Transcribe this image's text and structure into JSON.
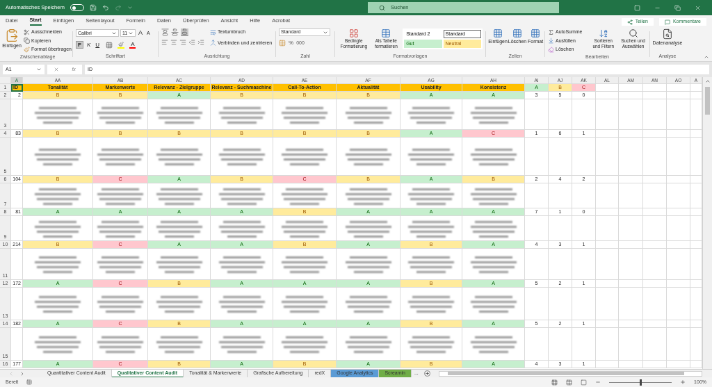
{
  "title_bar": {
    "autosave_label": "Automatisches Speichern",
    "autosave_on": false,
    "search_placeholder": "Suchen"
  },
  "menu": {
    "tabs": [
      {
        "label": "Datei",
        "selected": false
      },
      {
        "label": "Start",
        "selected": true
      },
      {
        "label": "Einfügen",
        "selected": false
      },
      {
        "label": "Seitenlayout",
        "selected": false
      },
      {
        "label": "Formeln",
        "selected": false
      },
      {
        "label": "Daten",
        "selected": false
      },
      {
        "label": "Überprüfen",
        "selected": false
      },
      {
        "label": "Ansicht",
        "selected": false
      },
      {
        "label": "Hilfe",
        "selected": false
      },
      {
        "label": "Acrobat",
        "selected": false
      }
    ],
    "share": "Teilen",
    "comments": "Kommentare"
  },
  "ribbon": {
    "clipboard": {
      "paste": "Einfügen",
      "cut": "Ausschneiden",
      "copy": "Kopieren",
      "format_painter": "Format übertragen",
      "label": "Zwischenablage"
    },
    "font": {
      "name": "Calibri",
      "size": "11",
      "grow": "A",
      "shrink": "A",
      "bold": "F",
      "bold_on": true,
      "italic": "K",
      "underline": "U",
      "font_color_label": "A",
      "label": "Schriftart"
    },
    "alignment": {
      "valign": [
        {
          "selected": false
        },
        {
          "selected": false
        },
        {
          "selected": true
        }
      ],
      "wrap": "Textumbruch",
      "merge": "Verbinden und zentrieren",
      "label": "Ausrichtung"
    },
    "number": {
      "format": "Standard",
      "percent": "%",
      "thousands": "000",
      "label": "Zahl"
    },
    "styles": {
      "conditional": "Bedingte Formatierung",
      "as_table": "Als Tabelle formatieren",
      "presets": [
        {
          "label": "Standard 2",
          "kind": "plain",
          "selected": false
        },
        {
          "label": "Standard",
          "kind": "plain",
          "selected": true
        },
        {
          "label": "Gut",
          "kind": "good",
          "selected": false
        },
        {
          "label": "Neutral",
          "kind": "neutral",
          "selected": false
        }
      ],
      "label": "Formatvorlagen"
    },
    "cells": {
      "insert": "Einfügen",
      "delete": "Löschen",
      "format": "Format",
      "label": "Zellen"
    },
    "editing": {
      "autosum": "AutoSumme",
      "fill": "Ausfüllen",
      "clear": "Löschen",
      "sort": "Sortieren und Filtern",
      "find": "Suchen und Auswählen",
      "label": "Bearbeiten"
    },
    "analysis": {
      "data_analysis": "Datenanalyse",
      "label": "Analyse"
    }
  },
  "formula_bar": {
    "cell": "A1",
    "fx": "fx",
    "value": "ID"
  },
  "sheet": {
    "columns": [
      "A",
      "AA",
      "AB",
      "AC",
      "AD",
      "AE",
      "AF",
      "AG",
      "AH",
      "AI",
      "AJ",
      "AK",
      "AL",
      "AM",
      "AN",
      "AO",
      "A"
    ],
    "header": {
      "row_number": "1",
      "id": "ID",
      "titles": [
        "Tonalität",
        "Markenwerte",
        "Relevanz - Zielgruppe",
        "Relevanz - Suchmaschine",
        "Call-To-Action",
        "Aktualität",
        "Usability",
        "Konsistenz"
      ],
      "tallies": [
        {
          "label": "A",
          "kind": "good"
        },
        {
          "label": "B",
          "kind": "neutral"
        },
        {
          "label": "C",
          "kind": "bad"
        }
      ]
    },
    "rows": [
      {
        "row_number": "2",
        "id": "2",
        "grades": [
          {
            "label": "B",
            "kind": "neutral"
          },
          {
            "label": "B",
            "kind": "neutral"
          },
          {
            "label": "A",
            "kind": "good"
          },
          {
            "label": "B",
            "kind": "neutral"
          },
          {
            "label": "B",
            "kind": "neutral"
          },
          {
            "label": "B",
            "kind": "neutral"
          },
          {
            "label": "A",
            "kind": "good"
          },
          {
            "label": "A",
            "kind": "good"
          }
        ],
        "counts": [
          "3",
          "5",
          "0"
        ],
        "notes_row_number": "3"
      },
      {
        "row_number": "4",
        "id": "83",
        "grades": [
          {
            "label": "B",
            "kind": "neutral"
          },
          {
            "label": "B",
            "kind": "neutral"
          },
          {
            "label": "B",
            "kind": "neutral"
          },
          {
            "label": "B",
            "kind": "neutral"
          },
          {
            "label": "B",
            "kind": "neutral"
          },
          {
            "label": "B",
            "kind": "neutral"
          },
          {
            "label": "A",
            "kind": "good"
          },
          {
            "label": "C",
            "kind": "bad"
          }
        ],
        "counts": [
          "1",
          "6",
          "1"
        ],
        "notes_row_number": "5"
      },
      {
        "row_number": "6",
        "id": "104",
        "grades": [
          {
            "label": "B",
            "kind": "neutral"
          },
          {
            "label": "C",
            "kind": "bad"
          },
          {
            "label": "A",
            "kind": "good"
          },
          {
            "label": "B",
            "kind": "neutral"
          },
          {
            "label": "C",
            "kind": "bad"
          },
          {
            "label": "B",
            "kind": "neutral"
          },
          {
            "label": "A",
            "kind": "good"
          },
          {
            "label": "B",
            "kind": "neutral"
          }
        ],
        "counts": [
          "2",
          "4",
          "2"
        ],
        "notes_row_number": "7"
      },
      {
        "row_number": "8",
        "id": "81",
        "grades": [
          {
            "label": "A",
            "kind": "good"
          },
          {
            "label": "A",
            "kind": "good"
          },
          {
            "label": "A",
            "kind": "good"
          },
          {
            "label": "A",
            "kind": "good"
          },
          {
            "label": "B",
            "kind": "neutral"
          },
          {
            "label": "A",
            "kind": "good"
          },
          {
            "label": "A",
            "kind": "good"
          },
          {
            "label": "A",
            "kind": "good"
          }
        ],
        "counts": [
          "7",
          "1",
          "0"
        ],
        "notes_row_number": "9"
      },
      {
        "row_number": "10",
        "id": "214",
        "grades": [
          {
            "label": "B",
            "kind": "neutral"
          },
          {
            "label": "C",
            "kind": "bad"
          },
          {
            "label": "A",
            "kind": "good"
          },
          {
            "label": "A",
            "kind": "good"
          },
          {
            "label": "B",
            "kind": "neutral"
          },
          {
            "label": "A",
            "kind": "good"
          },
          {
            "label": "B",
            "kind": "neutral"
          },
          {
            "label": "A",
            "kind": "good"
          }
        ],
        "counts": [
          "4",
          "3",
          "1"
        ],
        "notes_row_number": "11"
      },
      {
        "row_number": "12",
        "id": "172",
        "grades": [
          {
            "label": "A",
            "kind": "good"
          },
          {
            "label": "C",
            "kind": "bad"
          },
          {
            "label": "B",
            "kind": "neutral"
          },
          {
            "label": "A",
            "kind": "good"
          },
          {
            "label": "A",
            "kind": "good"
          },
          {
            "label": "A",
            "kind": "good"
          },
          {
            "label": "B",
            "kind": "neutral"
          },
          {
            "label": "A",
            "kind": "good"
          }
        ],
        "counts": [
          "5",
          "2",
          "1"
        ],
        "notes_row_number": "13"
      },
      {
        "row_number": "14",
        "id": "182",
        "grades": [
          {
            "label": "A",
            "kind": "good"
          },
          {
            "label": "C",
            "kind": "bad"
          },
          {
            "label": "B",
            "kind": "neutral"
          },
          {
            "label": "A",
            "kind": "good"
          },
          {
            "label": "A",
            "kind": "good"
          },
          {
            "label": "A",
            "kind": "good"
          },
          {
            "label": "B",
            "kind": "neutral"
          },
          {
            "label": "A",
            "kind": "good"
          }
        ],
        "counts": [
          "5",
          "2",
          "1"
        ],
        "notes_row_number": "15"
      },
      {
        "row_number": "16",
        "id": "177",
        "grades": [
          {
            "label": "A",
            "kind": "good"
          },
          {
            "label": "C",
            "kind": "bad"
          },
          {
            "label": "B",
            "kind": "neutral"
          },
          {
            "label": "A",
            "kind": "good"
          },
          {
            "label": "B",
            "kind": "neutral"
          },
          {
            "label": "A",
            "kind": "good"
          },
          {
            "label": "B",
            "kind": "neutral"
          },
          {
            "label": "A",
            "kind": "good"
          }
        ],
        "counts": [
          "4",
          "3",
          "1"
        ]
      }
    ]
  },
  "sheet_tabs": [
    {
      "label": "Quantitativer Content Audit",
      "selected": false
    },
    {
      "label": "Qualitativer Content Audit",
      "selected": true
    },
    {
      "label": "Tonalität & Markenwerte",
      "selected": false
    },
    {
      "label": "Grafische Aufbereitung",
      "selected": false
    },
    {
      "label": "redX",
      "selected": false
    },
    {
      "label": "Google Analytics",
      "selected": false,
      "color": "#5b9bd5"
    },
    {
      "label": "Screamin",
      "selected": false,
      "color": "#70ad47"
    }
  ],
  "more_tabs": "...",
  "status_bar": {
    "state": "Bereit",
    "zoom": "100%",
    "zoom_slider": {
      "level": 0.5
    }
  }
}
